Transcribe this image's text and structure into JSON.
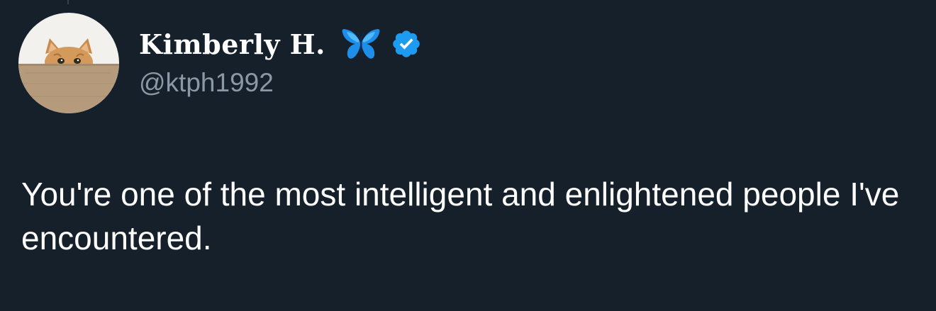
{
  "tweet": {
    "author": {
      "display_name": "Kimberly H.",
      "handle": "@ktph1992",
      "name_emoji": "butterfly-icon",
      "verified_icon": "verified-badge-icon",
      "verified_color": "#1d9bf0"
    },
    "text": "You're one of the most intelligent and enlightened people I've encountered."
  },
  "theme": {
    "background": "#15202b",
    "text": "#ffffff",
    "secondary_text": "#8b98a5"
  }
}
